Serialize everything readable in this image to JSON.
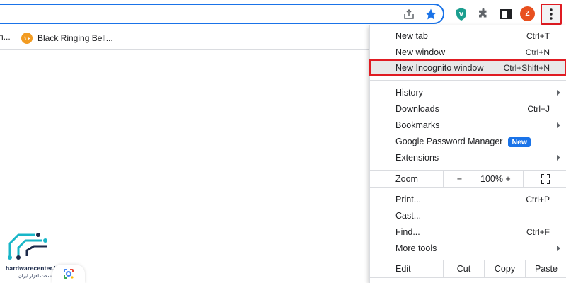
{
  "toolbar": {
    "profile_initial": "Z",
    "icons": [
      "share-icon",
      "bookmark-star-icon",
      "extension-shield-icon",
      "puzzle-icon",
      "side-panel-icon",
      "kebab-menu-icon"
    ],
    "accent": "#1a73e8",
    "profile_color": "#e8501f",
    "highlight_color": "#e01b22"
  },
  "bookmarks": {
    "partial_label": "n...",
    "items": [
      {
        "label": "Black Ringing Bell...",
        "favicon_text": "۱۶"
      }
    ]
  },
  "menu": {
    "items": [
      {
        "label": "New tab",
        "shortcut": "Ctrl+T"
      },
      {
        "label": "New window",
        "shortcut": "Ctrl+N"
      },
      {
        "label": "New Incognito window",
        "shortcut": "Ctrl+Shift+N"
      },
      {
        "label": "History",
        "shortcut": ""
      },
      {
        "label": "Downloads",
        "shortcut": "Ctrl+J"
      },
      {
        "label": "Bookmarks",
        "shortcut": ""
      },
      {
        "label": "Google Password Manager",
        "shortcut": "",
        "badge": "New"
      },
      {
        "label": "Extensions",
        "shortcut": ""
      },
      {
        "label": "Print...",
        "shortcut": "Ctrl+P"
      },
      {
        "label": "Cast...",
        "shortcut": ""
      },
      {
        "label": "Find...",
        "shortcut": "Ctrl+F"
      },
      {
        "label": "More tools",
        "shortcut": ""
      }
    ],
    "zoom": {
      "label": "Zoom",
      "minus": "−",
      "value": "100%",
      "plus": "+"
    },
    "edit": {
      "label": "Edit",
      "cut": "Cut",
      "copy": "Copy",
      "paste": "Paste"
    }
  },
  "watermark": {
    "site": "hardwarecenter.ir",
    "tagline": "مرکز سخت افزار ایران"
  }
}
